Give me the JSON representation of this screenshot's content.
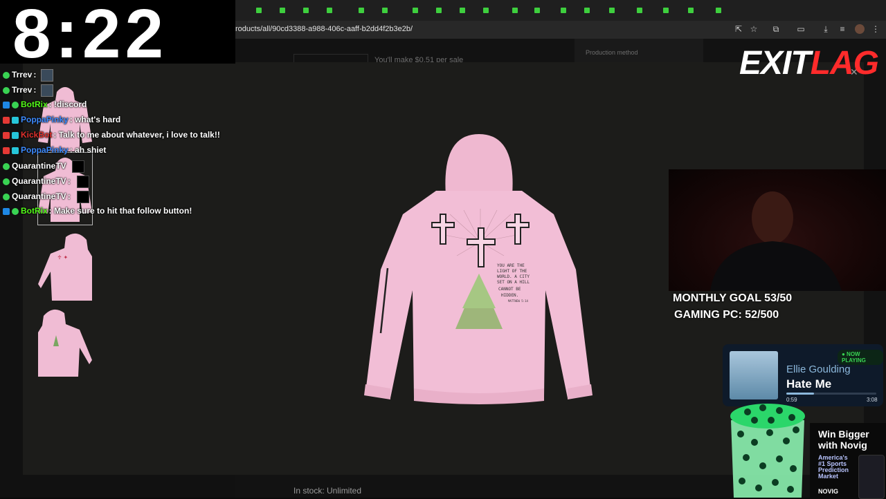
{
  "clock": {
    "time": "8:22"
  },
  "browser": {
    "url": "roducts/all/90cd3388-a988-406c-aaff-b2dd4f2b3e2b/"
  },
  "background_page": {
    "earnings_text": "You'll make $0.51 per sale",
    "production_label": "Production method",
    "stock_text": "In stock: Unlimited"
  },
  "chat": {
    "messages": [
      {
        "user": "Trrev",
        "text": "",
        "user_color": "#ffffff",
        "emote": true
      },
      {
        "user": "Trrev",
        "text": "",
        "user_color": "#ffffff",
        "emote": true
      },
      {
        "user": "BotRix",
        "text": "!discord",
        "user_color": "#53fc18"
      },
      {
        "user": "PoppaPinky",
        "text": "what's hard",
        "user_color": "#3d8bff"
      },
      {
        "user": "KickBot",
        "text": "Talk to me about whatever, i love to talk!!",
        "user_color": "#e0312d"
      },
      {
        "user": "PoppaPinky",
        "text": "ah shiet",
        "user_color": "#3d8bff"
      },
      {
        "user": "QuarantineTV",
        "text": "",
        "user_color": "#ffffff"
      },
      {
        "user": "QuarantineTV",
        "text": "",
        "user_color": "#ffffff"
      },
      {
        "user": "QuarantineTV",
        "text": "",
        "user_color": "#ffffff"
      },
      {
        "user": "BotRix",
        "text": "Make sure to hit that follow button!",
        "user_color": "#53fc18"
      }
    ]
  },
  "product": {
    "verse": [
      "YOU ARE THE",
      "LIGHT OF THE",
      "WORLD. A CITY",
      "SET ON A HILL",
      "CANNOT BE",
      "HIDDEN."
    ],
    "reference": "MATTHEW 5:14",
    "color": "#f0bcd4"
  },
  "overlay": {
    "logo_left": "EXIT",
    "logo_right": "LAG",
    "goal_line1": "MONTHLY GOAL 53/50",
    "goal_line2": "GAMING PC: 52/500"
  },
  "now_playing": {
    "badge": "● NOW PLAYING",
    "artist": "Ellie Goulding",
    "title": "Hate Me",
    "elapsed": "0:59",
    "duration": "3:08",
    "progress": 0.31
  },
  "ad": {
    "headline_1": "Win Bigger",
    "headline_2": "with Novig",
    "sub": [
      "America's",
      "#1 Sports",
      "Prediction",
      "Market"
    ],
    "brand": "NOVIG"
  },
  "colors": {
    "accent_red": "#ff2b2b",
    "chat_green": "#39d353"
  }
}
